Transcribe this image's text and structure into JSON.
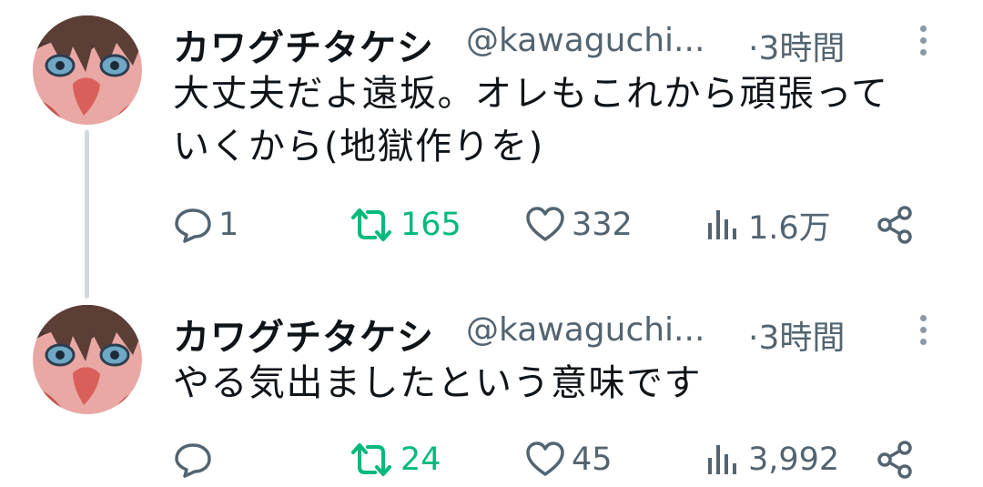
{
  "tweets": [
    {
      "display_name": "カワグチタケシ",
      "handle": "@kawaguchi...",
      "time": "·3時間",
      "text_lines": [
        "大丈夫だよ遠坂。オレもこれから頑張って",
        "いくから(地獄作りを)"
      ],
      "replies": "1",
      "retweets": "165",
      "likes": "332",
      "views": "1.6万"
    },
    {
      "display_name": "カワグチタケシ",
      "handle": "@kawaguchi...",
      "time": "·3時間",
      "text_lines": [
        "やる気出ましたという意味です"
      ],
      "replies": "",
      "retweets": "24",
      "likes": "45",
      "views": "3,992"
    }
  ],
  "icons": {
    "reply": "reply-bubble-icon",
    "retweet": "retweet-icon",
    "like": "heart-icon",
    "views": "views-bar-chart-icon",
    "share": "share-icon",
    "more": "vertical-ellipsis-icon"
  },
  "colors": {
    "text": "#0f1419",
    "secondary": "#536471",
    "retweet_active": "#00ba7c",
    "thread_line": "#cfd9de"
  }
}
